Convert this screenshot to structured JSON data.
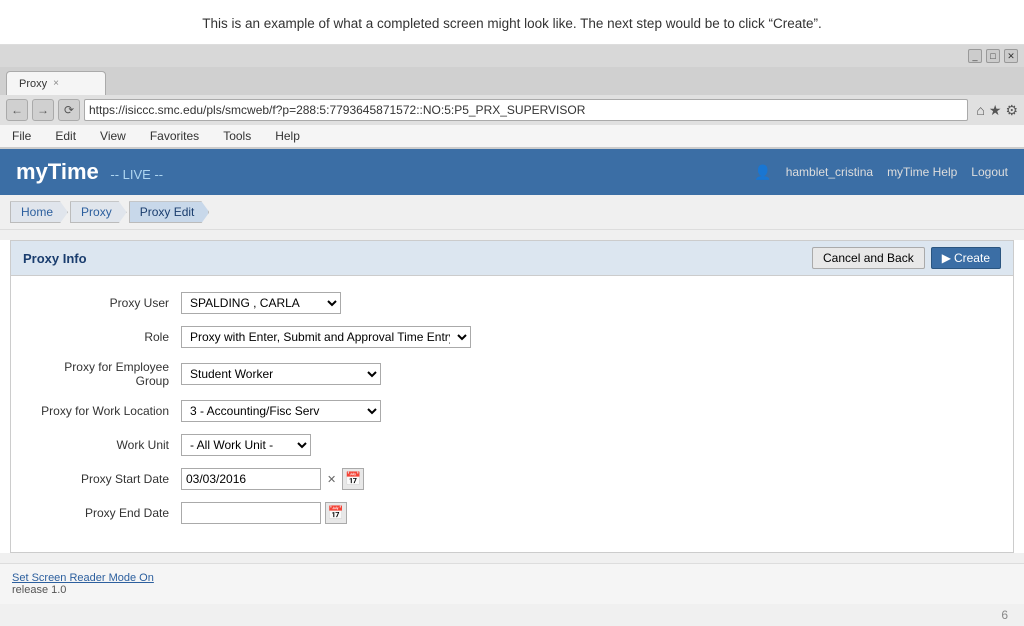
{
  "annotation": {
    "text": "This is an example of what a completed screen might look like.  The next step would be to click “Create”."
  },
  "browser": {
    "url": "https://isiccc.smc.edu/pls/smcweb/f?p=288:5:7793645871572::NO:5:P5_PRX_SUPERVISOR",
    "tab_label": "Proxy",
    "tab_close": "×",
    "menu": [
      "File",
      "Edit",
      "View",
      "Favorites",
      "Tools",
      "Help"
    ],
    "nav_back": "←",
    "nav_forward": "→",
    "nav_refresh": "⟳"
  },
  "app": {
    "logo": "myTime",
    "live_label": "-- LIVE --",
    "user": "hamblet_cristina",
    "help_link": "myTime Help",
    "logout_link": "Logout"
  },
  "breadcrumb": {
    "items": [
      "Home",
      "Proxy",
      "Proxy Edit"
    ]
  },
  "proxy_info": {
    "section_title": "Proxy Info",
    "cancel_btn": "Cancel and Back",
    "create_btn": "Create",
    "fields": {
      "proxy_user_label": "Proxy User",
      "proxy_user_value": "SPALDING , CARLA",
      "role_label": "Role",
      "role_value": "Proxy with Enter, Submit and Approval Time Entry Privilege",
      "proxy_employee_group_label": "Proxy for Employee Group",
      "proxy_employee_group_value": "Student Worker",
      "proxy_work_location_label": "Proxy for Work Location",
      "proxy_work_location_value": "3 - Accounting/Fisc Serv",
      "work_unit_label": "Work Unit",
      "work_unit_value": "- All Work Unit -",
      "proxy_start_date_label": "Proxy Start Date",
      "proxy_start_date_value": "03/03/2016",
      "proxy_end_date_label": "Proxy End Date",
      "proxy_end_date_value": ""
    }
  },
  "footer": {
    "link_text": "Set Screen Reader Mode On",
    "release": "release 1.0"
  },
  "page_number": "6"
}
